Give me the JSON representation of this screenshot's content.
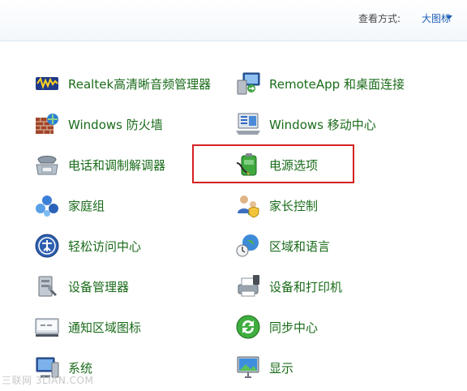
{
  "toolbar": {
    "view_label": "查看方式:",
    "view_value": "大图标"
  },
  "items": [
    {
      "label": "Realtek高清晰音频管理器",
      "icon": "audio-manager-icon"
    },
    {
      "label": "RemoteApp 和桌面连接",
      "icon": "remote-desktop-icon"
    },
    {
      "label": "Windows 防火墙",
      "icon": "firewall-icon"
    },
    {
      "label": "Windows 移动中心",
      "icon": "mobility-center-icon"
    },
    {
      "label": "电话和调制解调器",
      "icon": "phone-modem-icon"
    },
    {
      "label": "电源选项",
      "icon": "power-options-icon"
    },
    {
      "label": "家庭组",
      "icon": "homegroup-icon"
    },
    {
      "label": "家长控制",
      "icon": "parental-controls-icon"
    },
    {
      "label": "轻松访问中心",
      "icon": "ease-of-access-icon"
    },
    {
      "label": "区域和语言",
      "icon": "region-language-icon"
    },
    {
      "label": "设备管理器",
      "icon": "device-manager-icon"
    },
    {
      "label": "设备和打印机",
      "icon": "devices-printers-icon"
    },
    {
      "label": "通知区域图标",
      "icon": "notification-area-icon"
    },
    {
      "label": "同步中心",
      "icon": "sync-center-icon"
    },
    {
      "label": "系统",
      "icon": "system-icon"
    },
    {
      "label": "显示",
      "icon": "display-icon"
    }
  ],
  "watermark": "三联网 3LIAN.COM",
  "colors": {
    "link_green": "#1a6b1a",
    "view_blue": "#1e5fb4",
    "highlight_red": "#d42222"
  }
}
